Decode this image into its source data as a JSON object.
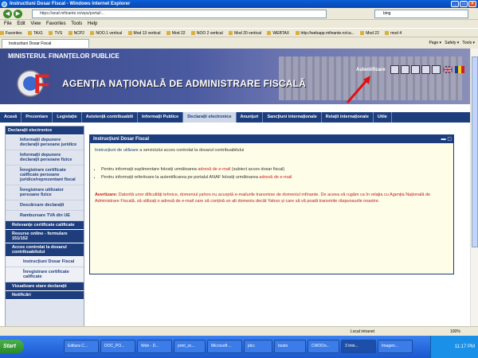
{
  "window": {
    "title": "Instructiuni Dosar Fiscal - Windows Internet Explorer",
    "icon": "ie-icon"
  },
  "address": {
    "url": "https://anaf.mfinante.ro/wps/portal/...",
    "search_value": "bing"
  },
  "menu": [
    "File",
    "Edit",
    "View",
    "Favorites",
    "Tools",
    "Help"
  ],
  "favorites": [
    "Favorites",
    "TAX1",
    "TVS",
    "NCP2",
    "NOO.1 vertical",
    "Mod 13 vertical",
    "Mod 22",
    "NOO 2 vertical",
    "Mod 20 vertical",
    "WEBTAX",
    "http://webapp.mfinante.ro/ca...",
    "Mod 22",
    "mod 4"
  ],
  "tab": {
    "label": "Instructiuni Dosar Fiscal"
  },
  "commands": [
    "Page",
    "Safety",
    "Tools"
  ],
  "header": {
    "ministry": "MINISTERUL FINANȚELOR PUBLICE",
    "agency": "AGENȚIA NAȚIONALĂ DE ADMINISTRARE FISCALĂ",
    "auth_link": "Autentificare"
  },
  "topnav": [
    "Acasă",
    "Prezentare",
    "Legislație",
    "Asistență contribuabili",
    "Informații Publice",
    "Declarații electronice",
    "Anunțuri",
    "Sancțiuni internaționale",
    "Relații internaționale",
    "Utile"
  ],
  "topnav_active": 5,
  "sidebar": {
    "section1": "Declarații electronice",
    "items": [
      "Informații depunere declarații persoane juridice",
      "Informații depunere declarații persoane fizice",
      "Înregistrare certificate calificate persoane juridice/reprezentant fiscal",
      "Înregistrare utilizator persoane fizice",
      "Descărcare declarații",
      "Rambursare TVA din UE"
    ],
    "sub1": "Relevanțe certificate calificate",
    "sub2": "Resurse online - formulare 151/152",
    "sub3": "Acces controlat la dosarul contribuabilului",
    "sub3_items": [
      "Instrucțiuni Dosar Fiscal",
      "Înregistrare certificate calificate"
    ],
    "sub4": "Vizualizare stare declarații",
    "sub5": "Notificări"
  },
  "panel": {
    "title": "Instrucțiuni Dosar Fiscal",
    "intro_a": "Instrucțiuni de utilizare",
    "intro_b": " a serviciului acces controlat la dosarul contribuabilului",
    "b1_a": "Pentru informații suplimentare folosiți următoarea ",
    "b1_link": "adresă de e-mail",
    "b1_b": " (subiect acces dosar fiscal)",
    "b2_a": "Pentru informații referitoare la autentificarea pe portalul ANAF folosiți următoarea ",
    "b2_link": "adresă de e-mail",
    "warn_label": "Avertizare:",
    "warn_text": " Datorită unor dificultăți tehnice, domeniul yahoo nu acceptă e-mailurile transmise de domeniul mfinante. De aceea vă rugăm ca în relația cu Agenția Națională de Administrare Fiscală, să utilizați o adresă de e-mail care să conțină un alt domeniu decât Yahoo și care să vă poată transmite răspunsurile noastre."
  },
  "status": {
    "text": "Local intranet",
    "zoom": "100%"
  },
  "taskbar": {
    "start": "Start",
    "tasks": [
      "Editura C...",
      "DOC_PO...",
      "Web - D...",
      "print_sc...",
      "Microsoft ...",
      "jdcc",
      "bosto",
      "CWODo...",
      "3 Inte...",
      "Imagen..."
    ],
    "active_task": 8,
    "clock": "11:17 PM"
  },
  "colors": {
    "nav": "#1d3d7d",
    "warn": "#c02020",
    "panel_bg": "#fdfde8"
  }
}
